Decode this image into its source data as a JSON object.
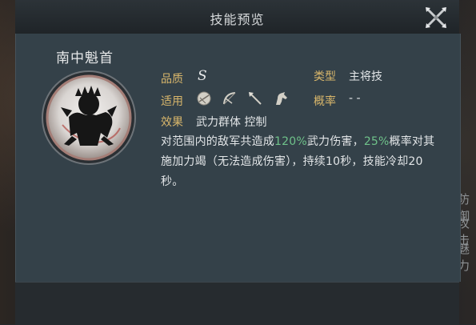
{
  "background": {
    "side_labels": [
      "防御",
      "攻击",
      "魅力"
    ]
  },
  "header": {
    "title": "技能预览",
    "close_icon": "close-x-icon"
  },
  "skill": {
    "name": "南中魁首",
    "quality_label": "品质",
    "quality_value": "S",
    "type_label": "类型",
    "type_value": "主将技",
    "applies_label": "适用",
    "applies_icons": [
      "shield-icon",
      "bow-icon",
      "spear-icon",
      "horse-icon"
    ],
    "chance_label": "概率",
    "chance_value": "- -",
    "effect_label": "效果",
    "effect_tags": "武力群体 控制",
    "description": {
      "p1": "对范围内的敌军共造成",
      "v1": "120%",
      "p2": "武力伤害，",
      "v2": "25%",
      "p3": "概率对其施加力竭（无法造成伤害），持续10秒，技能冷却20秒。"
    }
  },
  "colors": {
    "label": "#d8b66b",
    "highlight": "#6fc28a",
    "panel": "#344149"
  }
}
